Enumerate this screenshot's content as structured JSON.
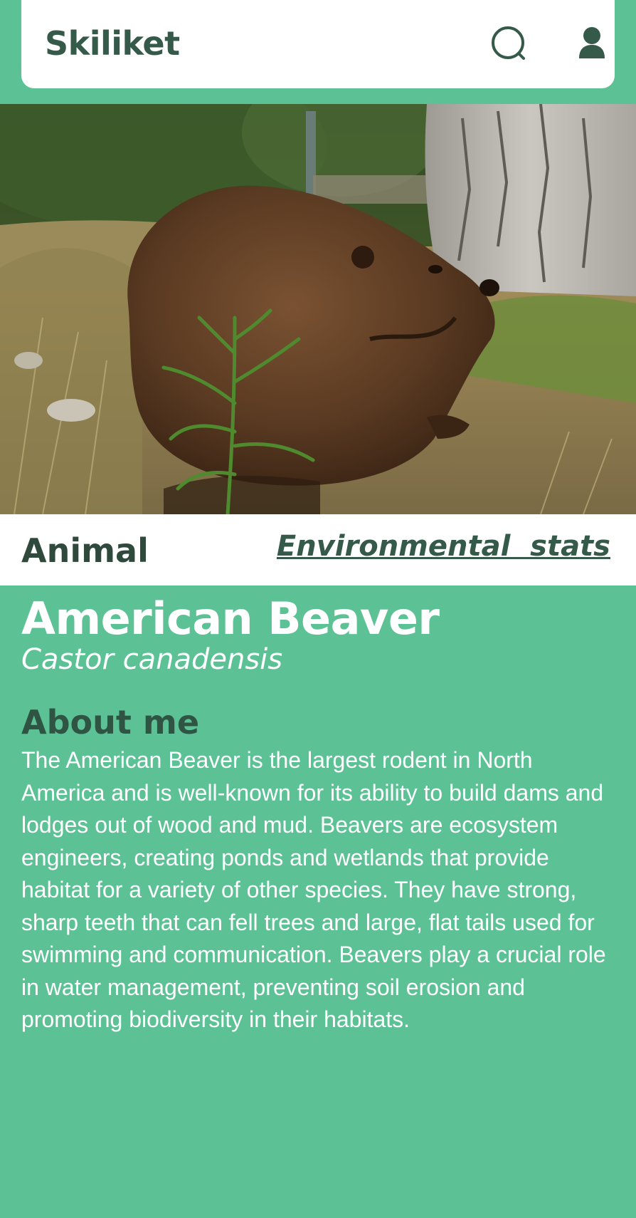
{
  "header": {
    "brand": "Skiliket",
    "search_icon": "search-icon",
    "profile_icon": "user-icon"
  },
  "hero": {
    "image_subject": "beaver-photo"
  },
  "label_bar": {
    "kind": "Animal",
    "link": "Environmental  stats"
  },
  "species": {
    "common_name": "American Beaver",
    "scientific_name": "Castor canadensis"
  },
  "about": {
    "heading": "About me",
    "text": "The American Beaver is the largest rodent in North America and is well-known for its ability to build dams and lodges out of wood and mud. Beavers are ecosystem engineers, creating ponds and wetlands that provide habitat for a variety of other species. They have strong, sharp teeth that can fell trees and large, flat tails used for swimming and communication. Beavers play a crucial role in water management, preventing soil erosion and promoting biodiversity in their habitats."
  },
  "colors": {
    "background": "#5cc295",
    "brand_text": "#355a4a",
    "surface": "#ffffff"
  }
}
